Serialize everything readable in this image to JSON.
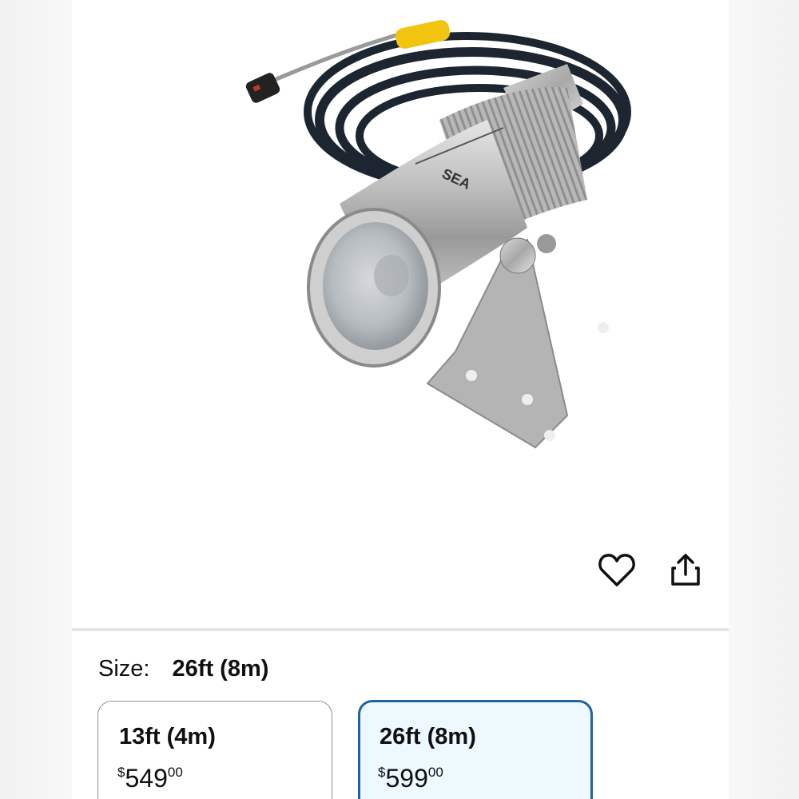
{
  "product": {
    "image_alt": "Stainless steel camera with mounting bracket and coiled black cable"
  },
  "actions": {
    "wishlist_icon": "heart-outline-icon",
    "share_icon": "share-icon"
  },
  "size_selector": {
    "label": "Size:",
    "selected": "26ft (8m)",
    "options": [
      {
        "title": "13ft (4m)",
        "currency": "$",
        "whole": "549",
        "fraction": "00",
        "selected": false
      },
      {
        "title": "26ft (8m)",
        "currency": "$",
        "whole": "599",
        "fraction": "00",
        "selected": true
      }
    ]
  },
  "colors": {
    "selected_border": "#2162a1",
    "selected_bg": "#edf8ff",
    "divider": "#e3e6e6"
  }
}
